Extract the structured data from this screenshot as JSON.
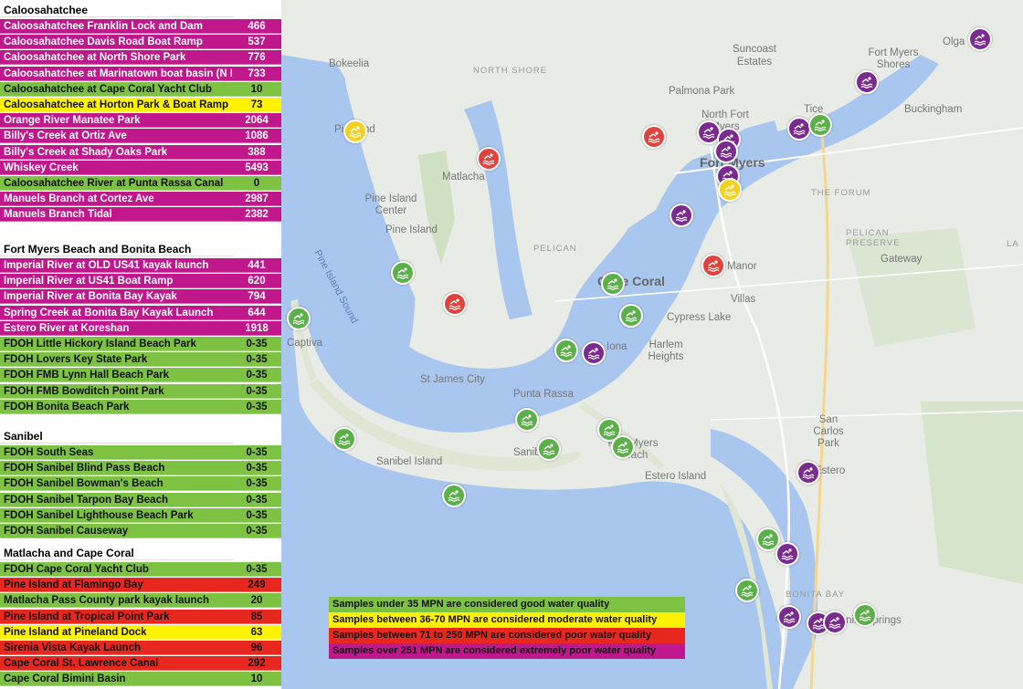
{
  "sections": [
    {
      "title": "Caloosahatchee",
      "rows": [
        {
          "name": "Caloosahatchee Franklin Lock and Dam",
          "value": "466",
          "status": "extreme"
        },
        {
          "name": "Caloosahatchee Davis Road Boat Ramp",
          "value": "537",
          "status": "extreme"
        },
        {
          "name": "Caloosahatchee at North Shore Park",
          "value": "776",
          "status": "extreme"
        },
        {
          "name": "Caloosahatchee at Marinatown boat basin (N FM)",
          "value": "733",
          "status": "extreme"
        },
        {
          "name": "Caloosahatchee at Cape Coral Yacht Club",
          "value": "10",
          "status": "good"
        },
        {
          "name": "Caloosahatchee at Horton Park & Boat Ramp",
          "value": "73",
          "status": "moderate"
        },
        {
          "name": "Orange River Manatee Park",
          "value": "2064",
          "status": "extreme"
        },
        {
          "name": "Billy's Creek at Ortiz Ave",
          "value": "1086",
          "status": "extreme"
        },
        {
          "name": "Billy's Creek at Shady Oaks Park",
          "value": "388",
          "status": "extreme"
        },
        {
          "name": "Whiskey Creek",
          "value": "5493",
          "status": "extreme"
        },
        {
          "name": "Caloosahatchee River at Punta Rassa Canal",
          "value": "0",
          "status": "good"
        },
        {
          "name": "Manuels Branch at Cortez Ave",
          "value": "2987",
          "status": "extreme"
        },
        {
          "name": "Manuels Branch Tidal",
          "value": "2382",
          "status": "extreme"
        }
      ]
    },
    {
      "title": "Fort Myers Beach and Bonita Beach",
      "rows": [
        {
          "name": "Imperial River at OLD US41 kayak launch",
          "value": "441",
          "status": "extreme"
        },
        {
          "name": "Imperial River at US41 Boat Ramp",
          "value": "620",
          "status": "extreme"
        },
        {
          "name": "Imperial River at Bonita Bay Kayak",
          "value": "794",
          "status": "extreme"
        },
        {
          "name": "Spring Creek at Bonita Bay Kayak Launch",
          "value": "644",
          "status": "extreme"
        },
        {
          "name": "Estero River at Koreshan",
          "value": "1918",
          "status": "extreme"
        },
        {
          "name": "FDOH Little Hickory Island Beach Park",
          "value": "0-35",
          "status": "good"
        },
        {
          "name": "FDOH Lovers Key State Park",
          "value": "0-35",
          "status": "good"
        },
        {
          "name": "FDOH FMB Lynn Hall Beach Park",
          "value": "0-35",
          "status": "good"
        },
        {
          "name": "FDOH FMB Bowditch Point Park",
          "value": "0-35",
          "status": "good"
        },
        {
          "name": "FDOH Bonita Beach Park",
          "value": "0-35",
          "status": "good"
        }
      ]
    },
    {
      "title": "Sanibel",
      "rows": [
        {
          "name": "FDOH South Seas",
          "value": "0-35",
          "status": "good"
        },
        {
          "name": "FDOH Sanibel Blind Pass Beach",
          "value": "0-35",
          "status": "good"
        },
        {
          "name": "FDOH Sanibel Bowman's Beach",
          "value": "0-35",
          "status": "good"
        },
        {
          "name": "FDOH Sanibel Tarpon Bay Beach",
          "value": "0-35",
          "status": "good"
        },
        {
          "name": "FDOH Sanibel Lighthouse Beach Park",
          "value": "0-35",
          "status": "good"
        },
        {
          "name": "FDOH Sanibel Causeway",
          "value": "0-35",
          "status": "good"
        }
      ]
    },
    {
      "title": "Matlacha and Cape Coral",
      "rows": [
        {
          "name": "FDOH Cape Coral Yacht Club",
          "value": "0-35",
          "status": "good"
        },
        {
          "name": "Pine Island at Flamingo Bay",
          "value": "249",
          "status": "poor"
        },
        {
          "name": "Matlacha Pass County park kayak launch",
          "value": "20",
          "status": "good"
        },
        {
          "name": "Pine Island at Tropical Point Park",
          "value": "85",
          "status": "poor"
        },
        {
          "name": "Pine Island at Pineland Dock",
          "value": "63",
          "status": "moderate"
        },
        {
          "name": "Sirenia Vista Kayak Launch",
          "value": "96",
          "status": "poor"
        },
        {
          "name": "Cape Coral St. Lawrence Canal",
          "value": "292",
          "status": "poor"
        },
        {
          "name": "Cape Coral Bimini Basin",
          "value": "10",
          "status": "good"
        }
      ]
    }
  ],
  "legend": [
    {
      "text": "Samples under 35 MPN are considered good water quality",
      "status": "good"
    },
    {
      "text": "Samples between 36-70 MPN are considered moderate water quality",
      "status": "moderate"
    },
    {
      "text": "Samples between 71 to 250 MPN are considered poor water quality",
      "status": "poor"
    },
    {
      "text": "Samples over 251 MPN are considered extremely poor water quality",
      "status": "extreme"
    }
  ],
  "map_labels": {
    "caloosahatchee": "Caloosahatchee",
    "suncoast_estates": "Suncoast Estates",
    "olga": "Olga",
    "fort_myers_shores": "Fort Myers Shores",
    "bokeelia": "Bokeelia",
    "north_shore": "NORTH SHORE",
    "palmona_park": "Palmona Park",
    "buckingham": "Buckingham",
    "north_fort_myers": "North Fort Myers",
    "tice": "Tice",
    "pineland": "Pineland",
    "fort_myers": "Fort Myers",
    "matlacha": "Matlacha",
    "the_forum": "THE FORUM",
    "pine_island_center": "Pine Island Center",
    "pine_island": "Pine Island",
    "pelican": "PELICAN",
    "pelican_preserve": "PELICAN PRESERVE",
    "gateway": "Gateway",
    "cape_coral": "Cape Coral",
    "manor": "Manor",
    "villas": "Villas",
    "cypress_lake": "Cypress Lake",
    "pine_island_sound": "Pine Island Sound",
    "captiva": "Captiva",
    "iona": "Iona",
    "harlem_heights": "Harlem Heights",
    "st_james_city": "St James City",
    "punta_rassa": "Punta Rassa",
    "san_carlos_park": "San Carlos Park",
    "sanibel_island": "Sanibel Island",
    "sanibel": "Sanibel",
    "fort_myers_beach": "Fort Myers Beach",
    "estero_island": "Estero Island",
    "estero": "Estero",
    "bonita_bay": "BONITA BAY",
    "bonita_springs": "Bonita Springs",
    "la": "LA"
  },
  "markers": [
    {
      "status": "extreme",
      "icon": "swimmer-icon"
    },
    {
      "status": "extreme",
      "icon": "swimmer-icon"
    },
    {
      "status": "moderate",
      "icon": "swimmer-icon"
    },
    {
      "status": "poor",
      "icon": "swimmer-icon"
    },
    {
      "status": "poor",
      "icon": "swimmer-icon"
    },
    {
      "status": "extreme",
      "icon": "swimmer-icon"
    },
    {
      "status": "extreme",
      "icon": "swimmer-icon"
    },
    {
      "status": "extreme",
      "icon": "swimmer-icon"
    },
    {
      "status": "extreme",
      "icon": "swimmer-icon"
    },
    {
      "status": "good",
      "icon": "swimmer-icon"
    },
    {
      "status": "extreme",
      "icon": "swimmer-icon"
    },
    {
      "status": "moderate",
      "icon": "swimmer-icon"
    },
    {
      "status": "extreme",
      "icon": "swimmer-icon"
    },
    {
      "status": "poor",
      "icon": "swimmer-icon"
    },
    {
      "status": "good",
      "icon": "swimmer-icon"
    },
    {
      "status": "poor",
      "icon": "swimmer-icon"
    },
    {
      "status": "good",
      "icon": "swimmer-icon"
    },
    {
      "status": "good",
      "icon": "swimmer-icon"
    },
    {
      "status": "good",
      "icon": "swimmer-icon"
    },
    {
      "status": "extreme",
      "icon": "swimmer-icon"
    },
    {
      "status": "good",
      "icon": "swimmer-icon"
    },
    {
      "status": "good",
      "icon": "swimmer-icon"
    },
    {
      "status": "good",
      "icon": "swimmer-icon"
    },
    {
      "status": "good",
      "icon": "swimmer-icon"
    },
    {
      "status": "good",
      "icon": "swimmer-icon"
    },
    {
      "status": "good",
      "icon": "swimmer-icon"
    },
    {
      "status": "good",
      "icon": "swimmer-icon"
    },
    {
      "status": "extreme",
      "icon": "swimmer-icon"
    },
    {
      "status": "good",
      "icon": "swimmer-icon"
    },
    {
      "status": "extreme",
      "icon": "swimmer-icon"
    },
    {
      "status": "good",
      "icon": "swimmer-icon"
    },
    {
      "status": "extreme",
      "icon": "swimmer-icon"
    },
    {
      "status": "extreme",
      "icon": "swimmer-icon"
    },
    {
      "status": "extreme",
      "icon": "swimmer-icon"
    },
    {
      "status": "good",
      "icon": "swimmer-icon"
    }
  ],
  "colors": {
    "good": "#7dc242",
    "moderate": "#fff200",
    "poor": "#e8281e",
    "extreme": "#c0188c",
    "water": "#a9c6ee",
    "land": "#e9ebe6"
  }
}
